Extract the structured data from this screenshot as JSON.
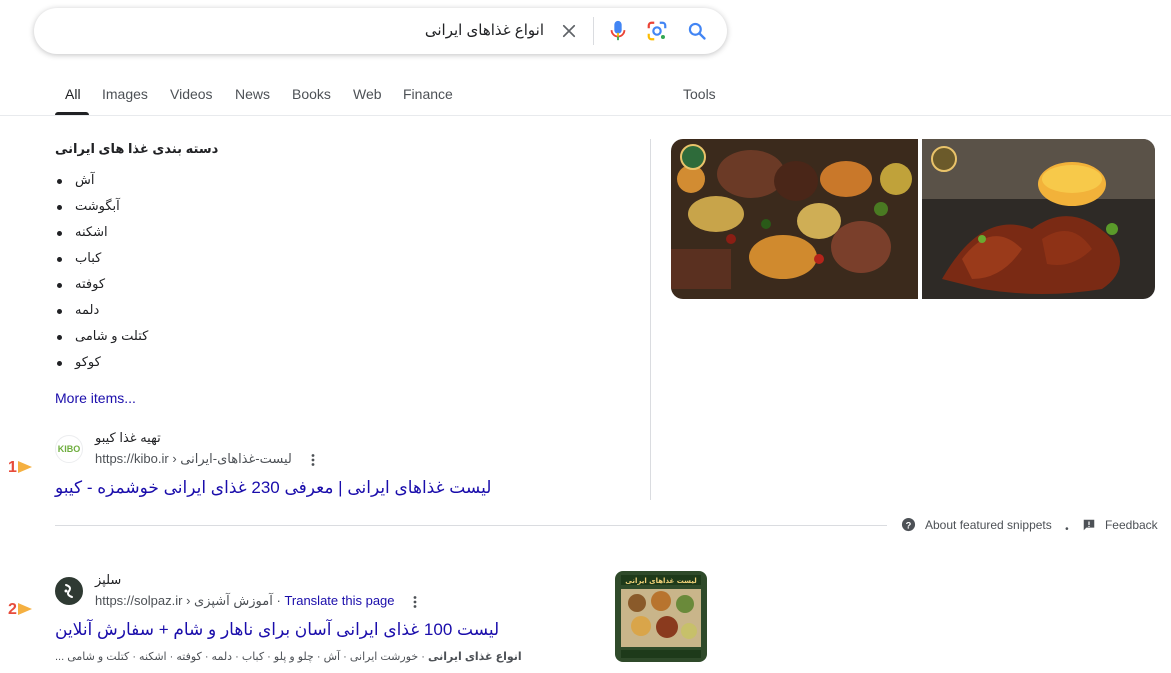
{
  "search": {
    "query": "انواع غذاهای ایرانی"
  },
  "tabs": [
    {
      "label": "All",
      "active": true
    },
    {
      "label": "Images"
    },
    {
      "label": "Videos"
    },
    {
      "label": "News"
    },
    {
      "label": "Books"
    },
    {
      "label": "Web"
    },
    {
      "label": "Finance"
    }
  ],
  "tools_label": "Tools",
  "featured": {
    "heading": "دسته بندی غذا های ایرانی",
    "items": [
      "آش",
      "آبگوشت",
      "اشکنه",
      "کباب",
      "کوفته",
      "دلمه",
      "کتلت و شامی",
      "کوکو"
    ],
    "more_items": "More items...",
    "source": {
      "name": "تهیه غذا کیبو",
      "url": "https://kibo.ir",
      "path": "› لیست-غذاهای-ایرانی",
      "favicon_text": "KIBO",
      "title": "لیست غذاهای ایرانی | معرفی 230 غذای ایرانی خوشمزه - کیبو"
    },
    "about_label": "About featured snippets",
    "feedback_label": "Feedback"
  },
  "markers": [
    "1",
    "2"
  ],
  "result2": {
    "name": "سلپز",
    "url": "https://solpaz.ir",
    "path": "› آموزش آشپزی",
    "translate": "Translate this page",
    "title": "لیست 100 غذای ایرانی آسان برای ناهار و شام + سفارش آنلاین",
    "snippet_bold": "انواع غذای ایرانی",
    "snippet_rest": "· خورشت ایرانی · آش · چلو و پلو · کباب · دلمه · کوفته · اشکنه · کتلت و شامی ...",
    "thumb_caption": "لیست غذاهای ایرانی"
  },
  "colors": {
    "link": "#1a0dab",
    "marker_num": "#e74c3c",
    "marker_arrow": "#f5b041"
  }
}
